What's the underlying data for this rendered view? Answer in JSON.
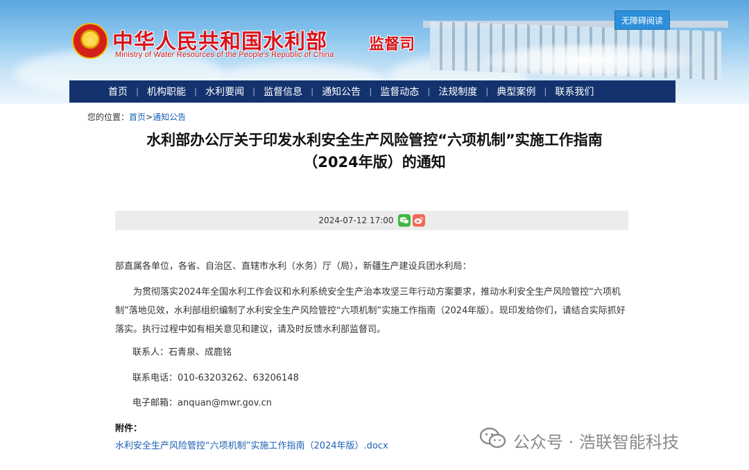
{
  "header": {
    "site_title_cn": "中华人民共和国水利部",
    "site_title_en": "Ministry of Water Resources of the People's Republic of China",
    "dept_name": "监督司",
    "accessibility_label": "无障碍阅读"
  },
  "nav": {
    "items": [
      {
        "label": "首页"
      },
      {
        "label": "机构职能"
      },
      {
        "label": "水利要闻"
      },
      {
        "label": "监督信息"
      },
      {
        "label": "通知公告"
      },
      {
        "label": "监督动态"
      },
      {
        "label": "法规制度"
      },
      {
        "label": "典型案例"
      },
      {
        "label": "联系我们"
      }
    ]
  },
  "breadcrumb": {
    "prefix": "您的位置：",
    "home": "首页",
    "separator": ">",
    "current": "通知公告"
  },
  "article": {
    "title_line1": "水利部办公厅关于印发水利安全生产风险管控“六项机制”实施工作指南",
    "title_line2": "（2024年版）的通知",
    "datetime": "2024-07-12 17:00",
    "salutation": "部直属各单位，各省、自治区、直辖市水利（水务）厅（局），新疆生产建设兵团水利局：",
    "main_paragraph": "为贯彻落实2024年全国水利工作会议和水利系统安全生产治本攻坚三年行动方案要求，推动水利安全生产风险管控“六项机制”落地见效，水利部组织编制了水利安全生产风险管控“六项机制”实施工作指南（2024年版）。现印发给你们，请结合实际抓好落实。执行过程中如有相关意见和建议，请及时反馈水利部监督司。",
    "contact_person": "联系人：石青泉、成鹿铭",
    "contact_phone": "联系电话：010-63203262、63206148",
    "contact_email": "电子邮箱：anquan@mwr.gov.cn",
    "attachment_label": "附件：",
    "attachment_link": "水利安全生产风险管控“六项机制”实施工作指南（2024年版）.docx"
  },
  "watermark": {
    "text": "公众号 · 浩联智能科技"
  },
  "colors": {
    "brand_red": "#d8141b",
    "nav_blue": "#14336e",
    "link_blue": "#1a5fb4",
    "wechat_green": "#3fb63f",
    "weibo_red": "#f06a55"
  }
}
